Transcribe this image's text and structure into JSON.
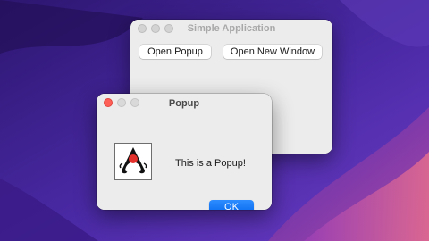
{
  "main_window": {
    "title": "Simple Application",
    "buttons": {
      "open_popup": "Open Popup",
      "open_new_window": "Open New Window"
    }
  },
  "popup": {
    "title": "Popup",
    "message": "This is a Popup!",
    "ok_label": "OK",
    "icon": "java-duke-icon"
  },
  "colors": {
    "default_button": "#0a6cf0",
    "close_button": "#fe5f57",
    "wallpaper_base": "#3a1f8a"
  }
}
